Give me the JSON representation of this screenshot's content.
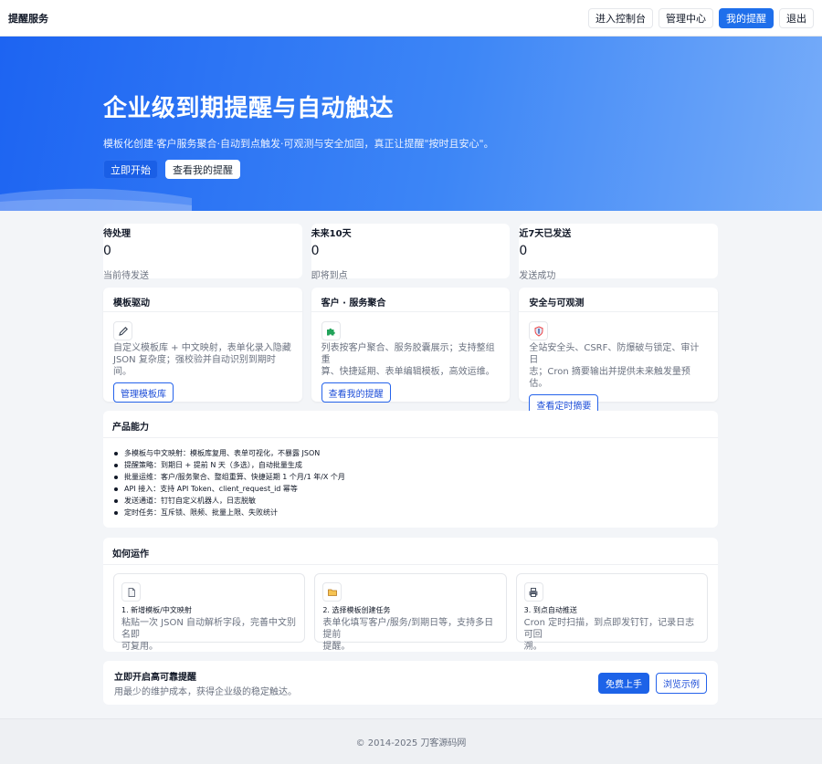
{
  "nav": {
    "brand": "提醒服务",
    "console": "进入控制台",
    "admin": "管理中心",
    "my_reminders": "我的提醒",
    "logout": "退出"
  },
  "hero": {
    "title": "企业级到期提醒与自动触达",
    "subtitle": "模板化创建·客户服务聚合·自动到点触发·可观测与安全加固，真正让提醒\"按时且安心\"。",
    "start": "立即开始",
    "view": "查看我的提醒"
  },
  "stats": [
    {
      "label": "待处理",
      "value": "0",
      "sub": "当前待发送"
    },
    {
      "label": "未来10天",
      "value": "0",
      "sub": "即将到点"
    },
    {
      "label": "近7天已发送",
      "value": "0",
      "sub": "发送成功"
    }
  ],
  "features": [
    {
      "title": "模板驱动",
      "icon": "pencil-icon",
      "desc1": "自定义模板库 + 中文映射，表单化录入隐藏",
      "desc2": "JSON 复杂度；强校验并自动识别到期时间。",
      "button": "管理模板库"
    },
    {
      "title": "客户 · 服务聚合",
      "icon": "puzzle-icon",
      "desc1": "列表按客户聚合、服务胶囊展示；支持整组重",
      "desc2": "算、快捷延期、表单编辑模板，高效运维。",
      "button": "查看我的提醒"
    },
    {
      "title": "安全与可观测",
      "icon": "shield-icon",
      "desc1": "全站安全头、CSRF、防爆破与锁定、审计日",
      "desc2": "志；Cron 摘要输出并提供未来触发量预估。",
      "button": "查看定时摘要"
    }
  ],
  "capabilities": {
    "title": "产品能力",
    "items": [
      "多模板与中文映射：模板库复用、表单可视化，不暴露 JSON",
      "提醒策略：到期日 + 提前 N 天（多选），自动批量生成",
      "批量运维：客户/服务聚合、整组重算、快捷延期 1 个月/1 年/X 个月",
      "API 接入：支持 API Token、client_request_id 幂等",
      "发送通道：钉钉自定义机器人，日志脱敏",
      "定时任务：互斥锁、限频、批量上限、失败统计"
    ]
  },
  "how": {
    "title": "如何运作",
    "steps": [
      {
        "icon": "document-icon",
        "title": "1. 新增模板/中文映射",
        "desc1": "粘贴一次 JSON 自动解析字段，完善中文别名即",
        "desc2": "可复用。"
      },
      {
        "icon": "folder-icon",
        "title": "2. 选择模板创建任务",
        "desc1": "表单化填写客户/服务/到期日等，支持多日提前",
        "desc2": "提醒。"
      },
      {
        "icon": "printer-icon",
        "title": "3. 到点自动推送",
        "desc1": "Cron 定时扫描，到点即发钉钉，记录日志可回",
        "desc2": "溯。"
      }
    ]
  },
  "cta": {
    "title": "立即开启高可靠提醒",
    "subtitle": "用最少的维护成本，获得企业级的稳定触达。",
    "primary": "免费上手",
    "secondary": "浏览示例"
  },
  "footer": {
    "text": "© 2014-2025 刀客源码网"
  },
  "colors": {
    "primary": "#1f6feb",
    "hero_start": "#1d64f2",
    "hero_end": "#76acf9"
  }
}
